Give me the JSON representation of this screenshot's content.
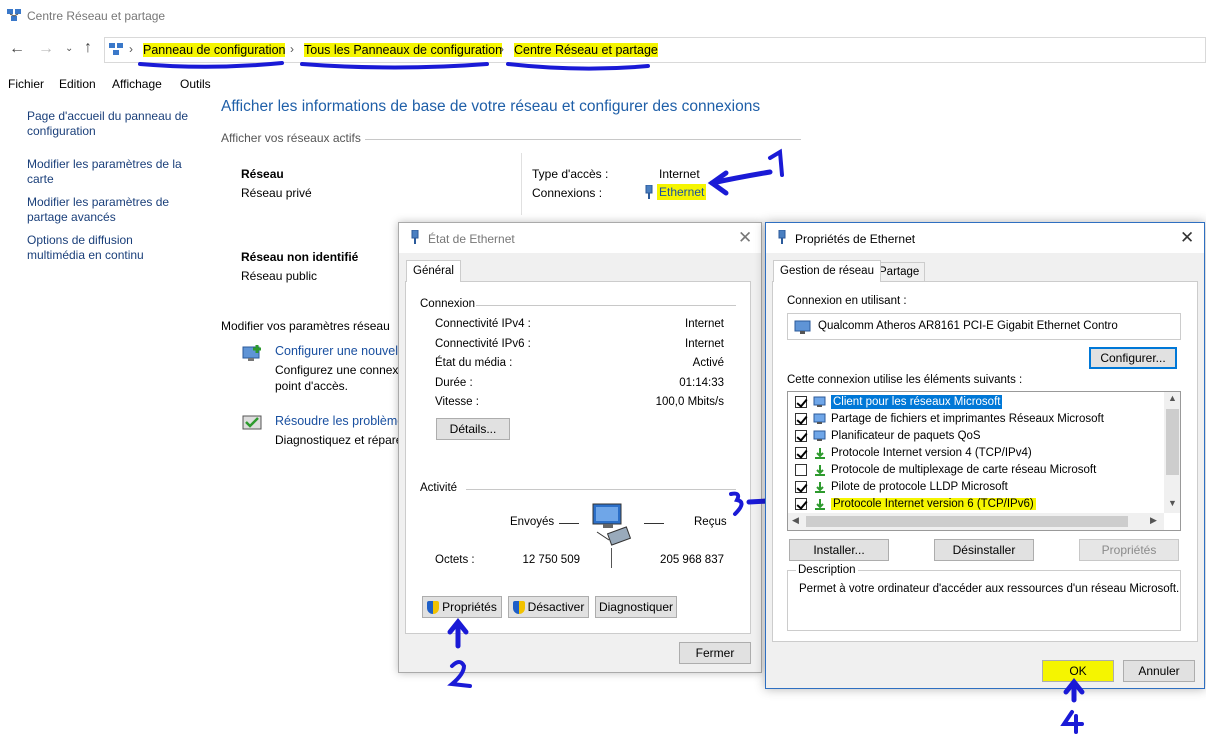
{
  "window": {
    "title": "Centre Réseau et partage"
  },
  "addressbar": {
    "crumbs": [
      "Panneau de configuration",
      "Tous les Panneaux de configuration",
      "Centre Réseau et partage"
    ]
  },
  "menubar": {
    "items": [
      "Fichier",
      "Edition",
      "Affichage",
      "Outils"
    ]
  },
  "sidebar": {
    "items": [
      "Page d'accueil du panneau de configuration",
      "Modifier les paramètres de la carte",
      "Modifier les paramètres de partage avancés",
      "Options de diffusion multimédia en continu"
    ]
  },
  "main": {
    "title": "Afficher les informations de base de votre réseau et configurer des connexions",
    "active_networks_label": "Afficher vos réseaux actifs",
    "net1": {
      "name": "Réseau",
      "type": "Réseau privé",
      "access_label": "Type d'accès :",
      "access_value": "Internet",
      "conn_label": "Connexions :",
      "conn_value": "Ethernet"
    },
    "net2": {
      "name": "Réseau non identifié",
      "type": "Réseau public"
    },
    "modify_label": "Modifier vos paramètres réseau",
    "task1": {
      "link": "Configurer une nouvelle",
      "desc1": "Configurez une connex",
      "desc2": "point d'accès."
    },
    "task2": {
      "link": "Résoudre les problèmes",
      "desc1": "Diagnostiquez et répare"
    }
  },
  "status_dialog": {
    "title": "État de Ethernet",
    "tab": "Général",
    "connection_group": "Connexion",
    "rows": [
      {
        "label": "Connectivité IPv4 :",
        "value": "Internet"
      },
      {
        "label": "Connectivité IPv6 :",
        "value": "Internet"
      },
      {
        "label": "État du média :",
        "value": "Activé"
      },
      {
        "label": "Durée :",
        "value": "01:14:33"
      },
      {
        "label": "Vitesse :",
        "value": "100,0 Mbits/s"
      }
    ],
    "details_button": "Détails...",
    "activity_group": "Activité",
    "sent_label": "Envoyés",
    "received_label": "Reçus",
    "bytes_label": "Octets :",
    "bytes_sent": "12 750 509",
    "bytes_received": "205 968 837",
    "properties_button": "Propriétés",
    "disable_button": "Désactiver",
    "diagnose_button": "Diagnostiquer",
    "close_button": "Fermer"
  },
  "props_dialog": {
    "title": "Propriétés de Ethernet",
    "tabs": [
      "Gestion de réseau",
      "Partage"
    ],
    "connect_using_label": "Connexion en utilisant :",
    "adapter": "Qualcomm Atheros AR8161 PCI-E Gigabit Ethernet Contro",
    "configure_button": "Configurer...",
    "items_label": "Cette connexion utilise les éléments suivants :",
    "items": [
      {
        "label": "Client pour les réseaux Microsoft",
        "checked": true
      },
      {
        "label": "Partage de fichiers et imprimantes Réseaux Microsoft",
        "checked": true
      },
      {
        "label": "Planificateur de paquets QoS",
        "checked": true
      },
      {
        "label": "Protocole Internet version 4 (TCP/IPv4)",
        "checked": true
      },
      {
        "label": "Protocole de multiplexage de carte réseau Microsoft",
        "checked": false
      },
      {
        "label": "Pilote de protocole LLDP Microsoft",
        "checked": true
      },
      {
        "label": "Protocole Internet version 6 (TCP/IPv6)",
        "checked": true
      }
    ],
    "install_button": "Installer...",
    "uninstall_button": "Désinstaller",
    "properties_button": "Propriétés",
    "description_label": "Description",
    "description_text": "Permet à votre ordinateur d'accéder aux ressources d'un réseau Microsoft.",
    "ok_button": "OK",
    "cancel_button": "Annuler"
  },
  "annotations": [
    "1",
    "2",
    "3",
    "4"
  ],
  "colors": {
    "highlight": "#f5f500",
    "link": "#1a50a0",
    "annotation": "#1a1ad6",
    "selection": "#0078d7"
  }
}
